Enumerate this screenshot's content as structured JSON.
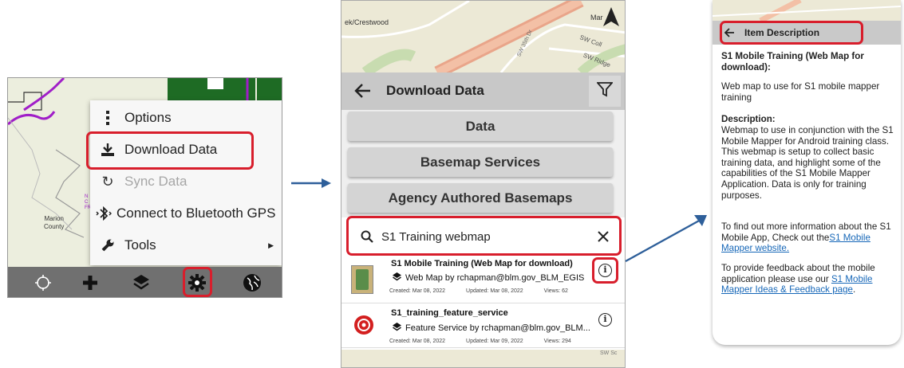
{
  "panel1": {
    "map": {
      "label_county": "Marion\nCounty",
      "label_fragment": "N\nC\nFR"
    },
    "menu": {
      "items": [
        {
          "label": "Options",
          "icon": "more-vertical-icon"
        },
        {
          "label": "Download Data",
          "icon": "download-icon"
        },
        {
          "label": "Sync Data",
          "icon": "sync-icon",
          "disabled": true
        },
        {
          "label": "Connect to Bluetooth GPS",
          "icon": "bluetooth-icon"
        },
        {
          "label": "Tools",
          "icon": "wrench-icon"
        }
      ]
    },
    "toolbar": {
      "icons": [
        "crosshair-icon",
        "plus-icon",
        "layers-icon",
        "gear-icon",
        "globe-icon"
      ]
    }
  },
  "panel2": {
    "map_labels": {
      "crestwood": "ek/Crestwood",
      "mar": "Mar",
      "street1": "SW 35th Dr",
      "street2": "SW Coll",
      "street3": "SW Ridge",
      "bottom": "SW Sc"
    },
    "header": {
      "title": "Download Data",
      "back_icon": "arrow-left-icon",
      "filter_icon": "filter-icon"
    },
    "buttons": [
      "Data",
      "Basemap Services",
      "Agency Authored Basemaps"
    ],
    "search": {
      "value": "S1 Training webmap",
      "search_icon": "search-icon",
      "clear_icon": "close-icon"
    },
    "results": [
      {
        "title": "S1 Mobile Training (Web Map for download)",
        "type_line": "Web Map by rchapman@blm.gov_BLM_EGIS",
        "created": "Created: Mar 08, 2022",
        "updated": "Updated: Mar 08, 2022",
        "views": "Views: 62"
      },
      {
        "title": "S1_training_feature_service",
        "type_line": "Feature Service by rchapman@blm.gov_BLM...",
        "created": "Created: Mar 08, 2022",
        "updated": "Updated: Mar 09, 2022",
        "views": "Views: 294"
      }
    ]
  },
  "panel3": {
    "header": {
      "title": "Item Description",
      "back_icon": "arrow-left-icon"
    },
    "item_title": "S1 Mobile Training (Web Map for download):",
    "summary": "Web map to use for S1 mobile mapper training",
    "description_label": "Description:",
    "description": "Webmap to use in conjunction with the S1 Mobile Mapper for Android training class.  This webmap is setup to collect basic training data, and highlight some of the capabilities of the S1 Mobile Mapper Application.  Data is only for training purposes.",
    "more_info_text": "To find out more information about the S1 Mobile App, Check out the",
    "more_info_link": "S1 Mobile Mapper website.",
    "feedback_text": "To provide feedback about the mobile application please use our ",
    "feedback_link": "S1 Mobile Mapper Ideas & Feedback page",
    "feedback_end": "."
  },
  "colors": {
    "highlight": "#d81e2c",
    "arrow": "#2e5f9a",
    "link": "#1667b8",
    "toolbar": "#707070"
  }
}
